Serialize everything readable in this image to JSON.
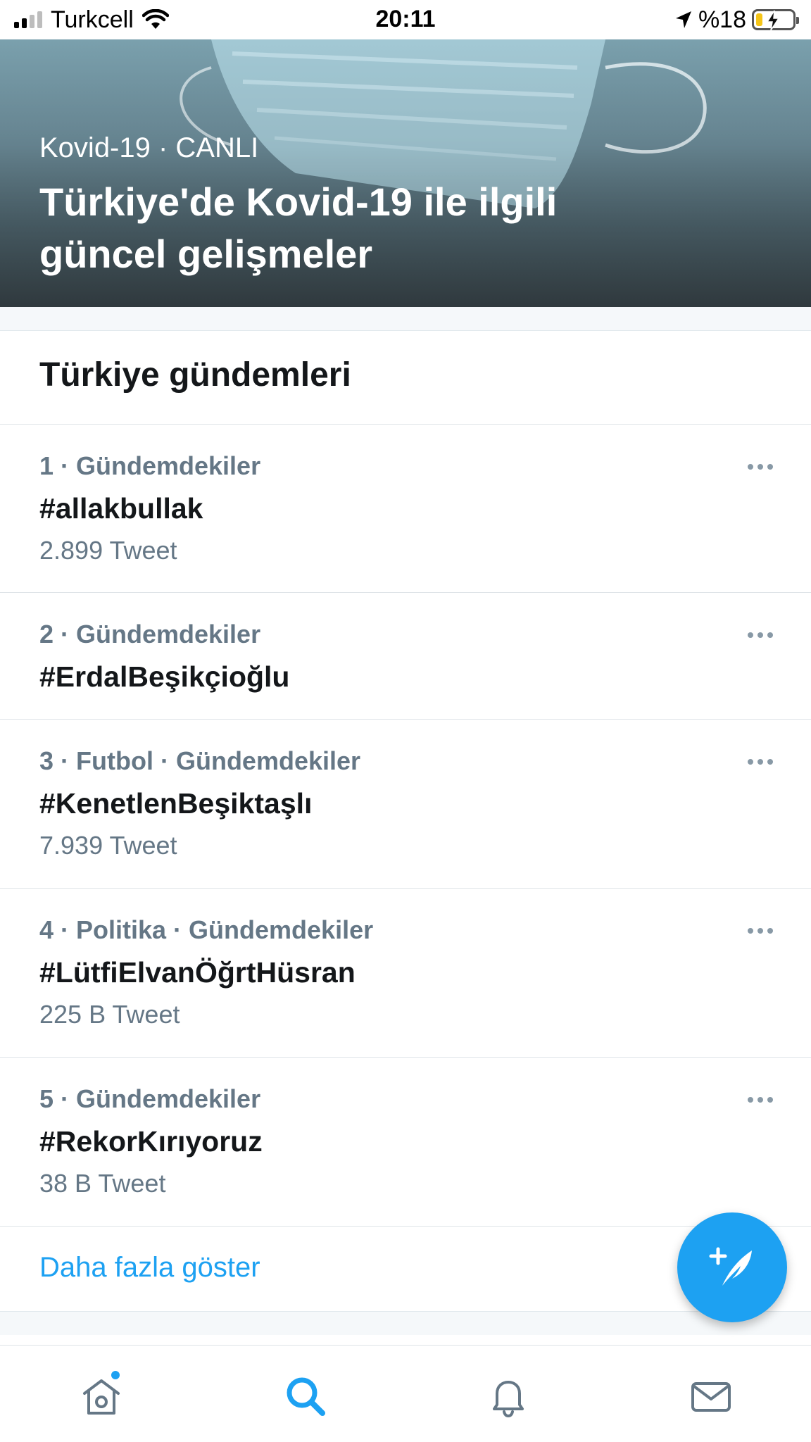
{
  "status_bar": {
    "carrier": "Turkcell",
    "time": "20:11",
    "battery": "%18",
    "battery_level": 0.18,
    "signal_bars": 2
  },
  "hero": {
    "meta": "Kovid-19 · CANLI",
    "title": "Türkiye'de Kovid-19 ile ilgili güncel gelişmeler"
  },
  "section": {
    "title": "Türkiye gündemleri"
  },
  "trends": [
    {
      "meta": "1 · Gündemdekiler",
      "name": "#allakbullak",
      "count": "2.899 Tweet"
    },
    {
      "meta": "2 · Gündemdekiler",
      "name": "#ErdalBeşikçioğlu",
      "count": ""
    },
    {
      "meta": "3 · Futbol · Gündemdekiler",
      "name": "#KenetlenBeşiktaşlı",
      "count": "7.939 Tweet"
    },
    {
      "meta": "4 · Politika · Gündemdekiler",
      "name": "#LütfiElvanÖğrtHüsran",
      "count": "225 B Tweet"
    },
    {
      "meta": "5 · Gündemdekiler",
      "name": "#RekorKırıyoruz",
      "count": "38 B Tweet"
    }
  ],
  "show_more": "Daha fazla göster",
  "colors": {
    "accent": "#1da1f2",
    "secondary_text": "#657786",
    "primary_text": "#14171a"
  },
  "icons": {
    "fab": "compose-tweet-icon",
    "tabs": [
      "home-icon",
      "search-icon",
      "notifications-icon",
      "messages-icon"
    ],
    "active_tab": "search-icon"
  }
}
